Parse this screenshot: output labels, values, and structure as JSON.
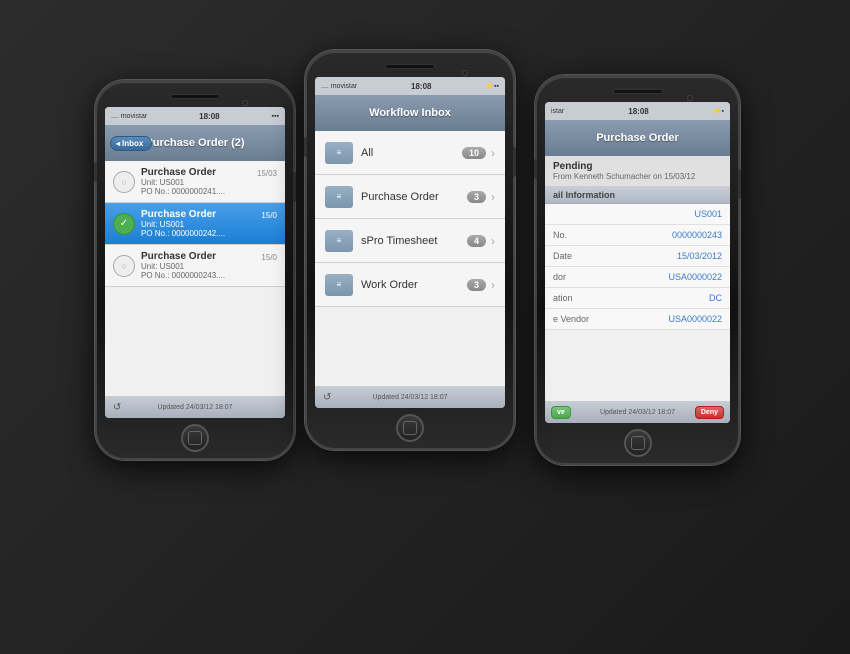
{
  "phones": {
    "left": {
      "carrier": ".... movistar",
      "time": "18:08",
      "nav_title": "Purchase Order (2)",
      "back_btn": "Inbox",
      "items": [
        {
          "title": "Purchase Order",
          "sub1": "Unit: US001",
          "sub2": "PO No.: 0000000241....",
          "date": "15/03",
          "selected": false,
          "has_check": false
        },
        {
          "title": "Purchase Order",
          "sub1": "Unit: US001",
          "sub2": "PO No.: 0000000242....",
          "date": "15/0",
          "selected": true,
          "has_check": true
        },
        {
          "title": "Purchase Order",
          "sub1": "Unit: US001",
          "sub2": "PO No.: 0000000243....",
          "date": "15/0",
          "selected": false,
          "has_check": false
        }
      ],
      "footer": "Updated 24/03/12 18:07"
    },
    "center": {
      "carrier": ".... movistar",
      "time": "18:08",
      "nav_title": "Workflow Inbox",
      "items": [
        {
          "label": "All",
          "badge": "10"
        },
        {
          "label": "Purchase Order",
          "badge": "3"
        },
        {
          "label": "sPro Timesheet",
          "badge": "4"
        },
        {
          "label": "Work Order",
          "badge": "3"
        }
      ],
      "footer": "Updated 24/03/12 18:07"
    },
    "right": {
      "carrier": "istar",
      "time": "18:08",
      "nav_title": "Purchase Order",
      "status_title": "Pending",
      "status_sub": "From Kenneth Schumacher on 15/03/12",
      "section_header": "ail Information",
      "rows": [
        {
          "label": "",
          "value": "US001"
        },
        {
          "label": "No.",
          "value": "0000000243"
        },
        {
          "label": "Date",
          "value": "15/03/2012"
        },
        {
          "label": "dor",
          "value": "USA0000022"
        },
        {
          "label": "ation",
          "value": "DC"
        },
        {
          "label": "e Vendor",
          "value": "USA0000022"
        }
      ],
      "footer": "Updated 24/03/12 18:07",
      "approve_btn": "ve",
      "deny_btn": "Deny"
    }
  }
}
